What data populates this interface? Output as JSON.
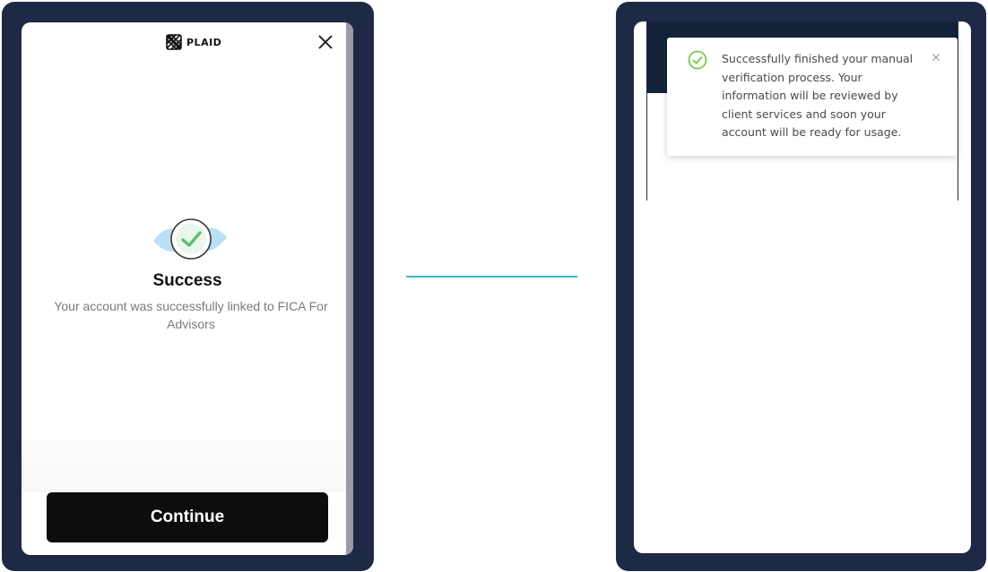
{
  "plaid_modal": {
    "logo_text": "PLAID",
    "close_icon": "close-icon",
    "success_icon": "check-circle-icon",
    "title": "Success",
    "description": "Your account was successfully linked to FICA For Advisors",
    "continue_label": "Continue"
  },
  "notification": {
    "icon": "check-circle-icon",
    "message": "Successfully finished your manual verification process. Your information will be reviewed by client services and soon your account will be ready for usage.",
    "close_icon": "close-icon"
  },
  "colors": {
    "frame": "#1e2a45",
    "connector": "#3bb9c3",
    "success_green": "#5bbf6a",
    "toast_check": "#7ac74f",
    "button": "#0d0d0d",
    "app_header": "#15233a"
  }
}
